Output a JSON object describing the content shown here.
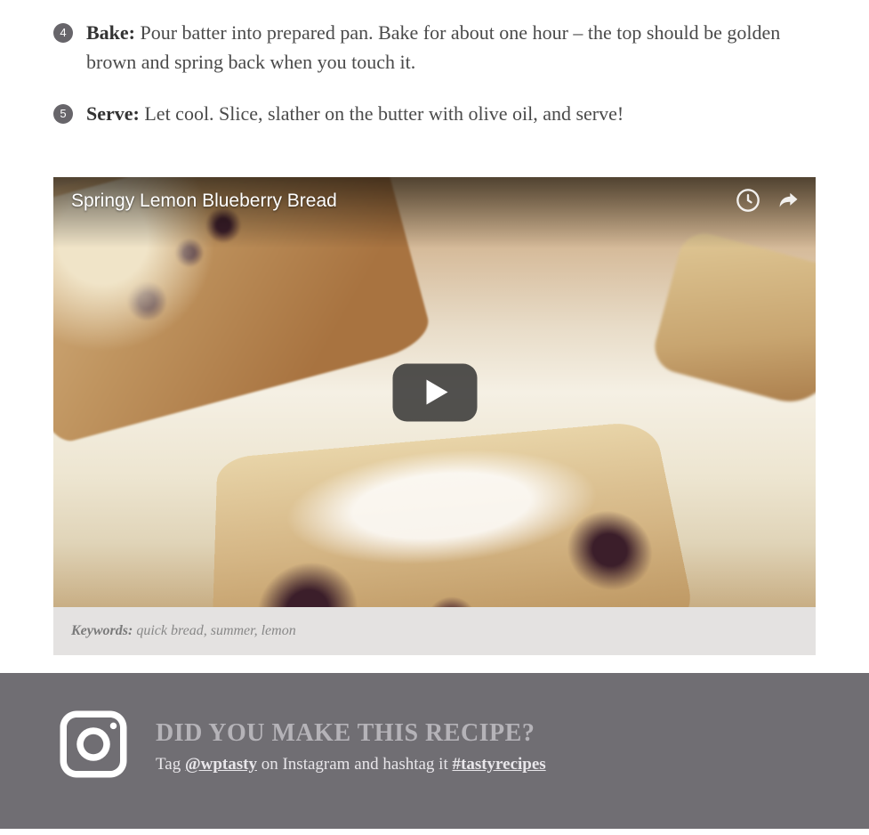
{
  "steps": [
    {
      "num": "4",
      "label": "Bake:",
      "text": "Pour batter into prepared pan. Bake for about one hour – the top should be golden brown and spring back when you touch it."
    },
    {
      "num": "5",
      "label": "Serve:",
      "text": "Let cool. Slice, slather on the butter with olive oil, and serve!"
    }
  ],
  "video": {
    "title": "Springy Lemon Blueberry Bread"
  },
  "keywords": {
    "label": "Keywords:",
    "value": "quick bread, summer, lemon"
  },
  "cta": {
    "heading": "DID YOU MAKE THIS RECIPE?",
    "tag_prefix": "Tag ",
    "handle": "@wptasty",
    "tag_mid": " on Instagram and hashtag it ",
    "hashtag": "#tastyrecipes"
  }
}
